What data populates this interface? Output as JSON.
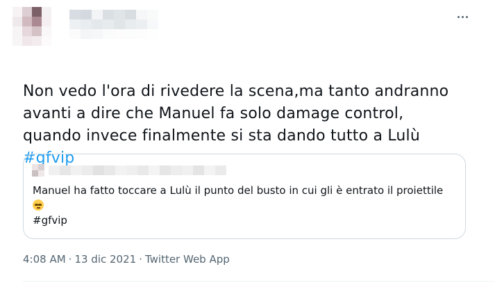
{
  "author": {
    "avatar_colors": [
      "#f7f2f4",
      "#d9c9ce",
      "#6e4f57",
      "#f4f0f1",
      "#efe7ea",
      "#cdb4bb",
      "#a27d87",
      "#f4eef0",
      "#f7f3f4",
      "#e3d3d8",
      "#d0bcc2",
      "#faf7f8",
      "#f8f5f6",
      "#efe5e8",
      "#f2ebed",
      "#fcfafb"
    ],
    "name_colors": [
      "#d7dde2",
      "#d3d9de",
      "#f2f4f6",
      "#dadfe3",
      "#dfe4e7",
      "#d8dde1",
      "#f6f7f8",
      "#f9fafa",
      "#eef1f3",
      "#eaedf0",
      "#e4e8eb",
      "#e8ebee",
      "#e0e5e8",
      "#e9ecef",
      "#eceff1",
      "#f7f8f9",
      "#fbfbfc",
      "#f3f5f6",
      "#f6f7f8",
      "#fafbfb",
      "#fcfcfd",
      "#fbfcfc",
      "#fdfdfe",
      "#fefefe"
    ]
  },
  "more_icon": "more-horizontal-icon",
  "tweet": {
    "text": "Non vedo l'ora di rivedere la scena,ma tanto andranno\navanti a dire che Manuel fa solo damage control,\nquando invece finalmente si sta dando tutto a Lulù",
    "hashtag": "#gfvip"
  },
  "quote": {
    "avatar_colors": [
      "#ece4e4",
      "#d8d0d2",
      "#c9c0c3",
      "#efe9ea"
    ],
    "name_colors": [
      "#f0f0f0",
      "#e6e6e6",
      "#f1f1f1",
      "#ececec",
      "#e2e2e2",
      "#e8e8e8",
      "#f2f2f2",
      "#efefef",
      "#e9e9e9",
      "#f4f4f4",
      "#e6e6e6",
      "#ededed",
      "#f0f0f0",
      "#e4e4e4",
      "#f3f3f3",
      "#ebebeb"
    ],
    "text": "Manuel ha fatto toccare a Lulù il punto del busto in cui gli è entrato il proiettile",
    "emoji": "pensive-face-emoji",
    "hashtag": "#gfvip"
  },
  "meta": {
    "time": "4:08 AM",
    "date": "13 dic 2021",
    "source": "Twitter Web App",
    "separator": "·"
  }
}
